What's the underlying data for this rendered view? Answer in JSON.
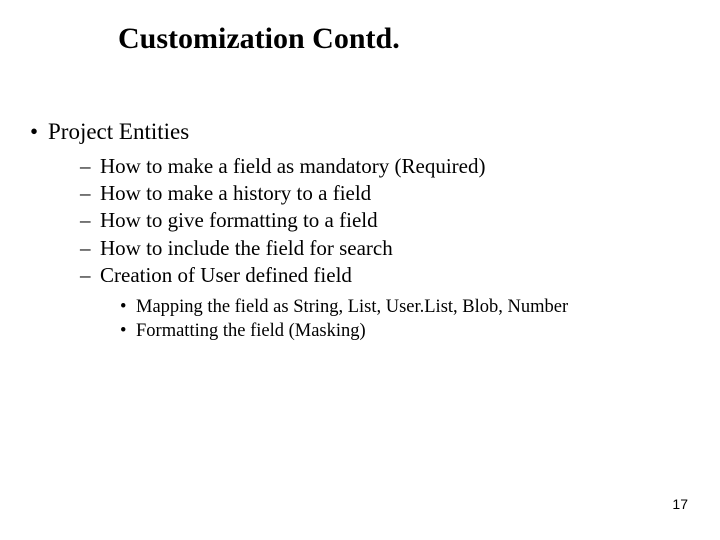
{
  "title": "Customization Contd.",
  "l1": {
    "item": "Project Entities"
  },
  "l2": {
    "items": [
      "How to make a field as mandatory (Required)",
      "How to make a history to a field",
      "How to give formatting to a field",
      "How to include the field for search",
      "Creation of User defined field"
    ]
  },
  "l3": {
    "items": [
      "Mapping the field as String, List, User.List, Blob, Number",
      "Formatting the field (Masking)"
    ]
  },
  "page_number": "17"
}
